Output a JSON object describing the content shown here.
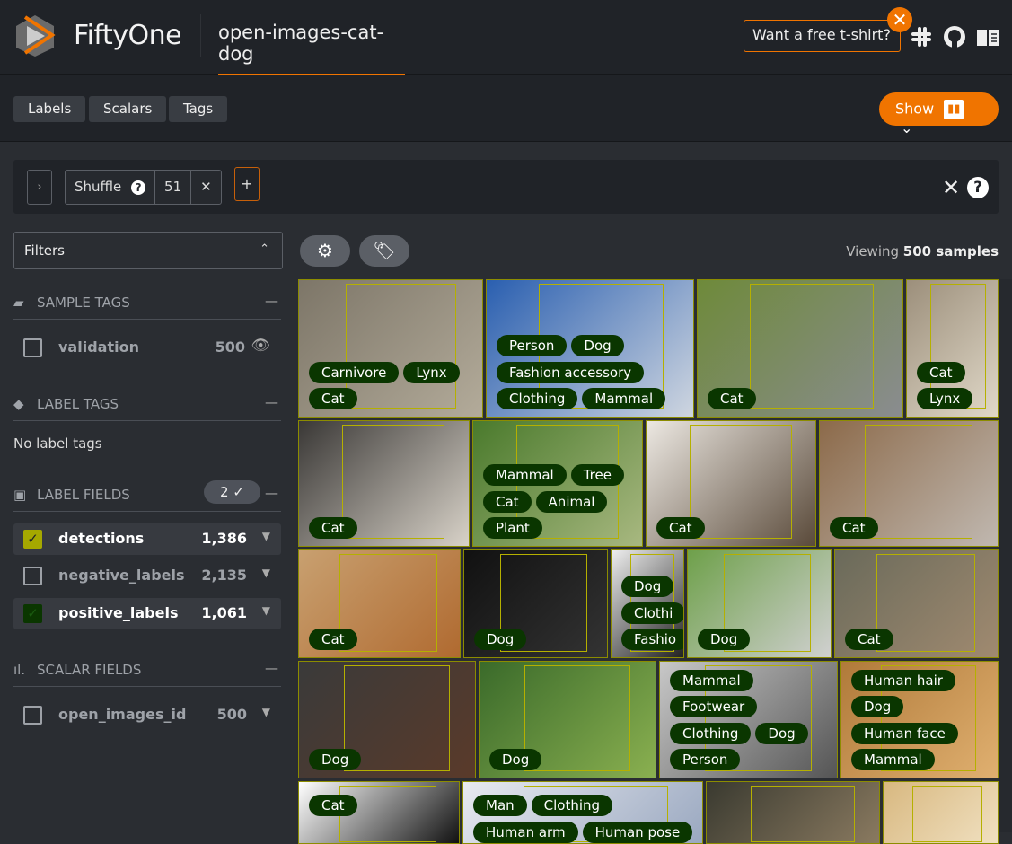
{
  "header": {
    "brand": "FiftyOne",
    "dataset": "open-images-cat-dog",
    "tshirt": "Want a free t-shirt?",
    "icons": [
      "slack-icon",
      "github-icon",
      "docs-icon"
    ]
  },
  "tabs": [
    "Labels",
    "Scalars",
    "Tags"
  ],
  "show_button": "Show",
  "view_bar": {
    "stage": "Shuffle",
    "stage_value": "51",
    "add": "+"
  },
  "sidebar": {
    "filters": "Filters",
    "sample_tags": {
      "title": "SAMPLE TAGS",
      "items": [
        {
          "name": "validation",
          "count": "500"
        }
      ]
    },
    "label_tags": {
      "title": "LABEL TAGS",
      "empty": "No label tags"
    },
    "label_fields": {
      "title": "LABEL FIELDS",
      "selected_count": "2",
      "items": [
        {
          "name": "detections",
          "count": "1,386",
          "checked": true,
          "color": "#a5a800"
        },
        {
          "name": "negative_labels",
          "count": "2,135",
          "checked": false
        },
        {
          "name": "positive_labels",
          "count": "1,061",
          "checked": true,
          "color": "#0a3600"
        }
      ]
    },
    "scalar_fields": {
      "title": "SCALAR FIELDS",
      "items": [
        {
          "name": "open_images_id",
          "count": "500"
        }
      ]
    }
  },
  "grid": {
    "viewing_prefix": "Viewing",
    "viewing_count": "500 samples",
    "tiles": [
      [
        [
          "Carnivore",
          "Lynx"
        ],
        [
          "Cat"
        ]
      ],
      [
        [
          "Person",
          "Dog"
        ],
        [
          "Fashion accessory"
        ],
        [
          "Clothing",
          "Mammal"
        ]
      ],
      [
        [
          "Cat"
        ]
      ],
      [
        [
          "Cat"
        ],
        [
          "Lynx"
        ]
      ],
      [
        [
          "Cat"
        ]
      ],
      [
        [
          "Mammal",
          "Tree"
        ],
        [
          "Cat",
          "Animal"
        ],
        [
          "Plant"
        ]
      ],
      [
        [
          "Cat"
        ]
      ],
      [
        [
          "Cat"
        ]
      ],
      [
        [
          "Cat"
        ]
      ],
      [
        [
          "Dog"
        ]
      ],
      [
        [
          "Dog"
        ],
        [
          "Clothi"
        ],
        [
          "Fashio"
        ]
      ],
      [
        [
          "Dog"
        ]
      ],
      [
        [
          "Cat"
        ]
      ],
      [
        [
          "Dog"
        ]
      ],
      [
        [
          "Dog"
        ]
      ],
      [
        [
          "Mammal"
        ],
        [
          "Footwear"
        ],
        [
          "Clothing",
          "Dog"
        ],
        [
          "Person"
        ]
      ],
      [
        [
          "Human hair"
        ],
        [
          "Dog"
        ],
        [
          "Human face"
        ],
        [
          "Mammal"
        ]
      ],
      [
        [
          "Cat"
        ]
      ],
      [
        [
          "Man",
          "Clothing"
        ],
        [
          "Human arm",
          "Human pose"
        ]
      ],
      [],
      []
    ]
  },
  "colors": {
    "accent": "#f07400",
    "label_pill": "#0a3600",
    "box": "#b5b000"
  }
}
